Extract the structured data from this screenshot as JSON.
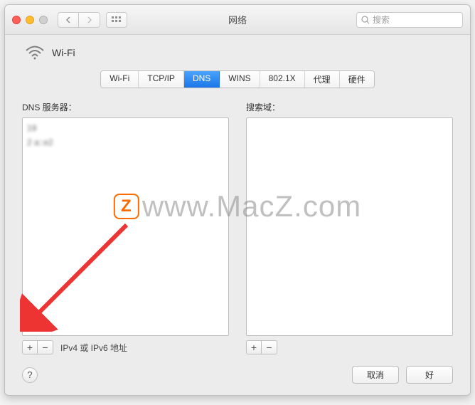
{
  "window": {
    "title": "网络",
    "search_placeholder": "搜索"
  },
  "interface": {
    "name": "Wi-Fi"
  },
  "tabs": [
    {
      "label": "Wi-Fi",
      "active": false
    },
    {
      "label": "TCP/IP",
      "active": false
    },
    {
      "label": "DNS",
      "active": true
    },
    {
      "label": "WINS",
      "active": false
    },
    {
      "label": "802.1X",
      "active": false
    },
    {
      "label": "代理",
      "active": false
    },
    {
      "label": "硬件",
      "active": false
    }
  ],
  "left_col": {
    "label": "DNS 服务器：",
    "entries": [
      "19",
      "2                         a::e2"
    ],
    "hint": "IPv4 或 IPv6 地址"
  },
  "right_col": {
    "label": "搜索域：",
    "entries": []
  },
  "buttons": {
    "cancel": "取消",
    "ok": "好"
  },
  "watermark": "www.MacZ.com"
}
